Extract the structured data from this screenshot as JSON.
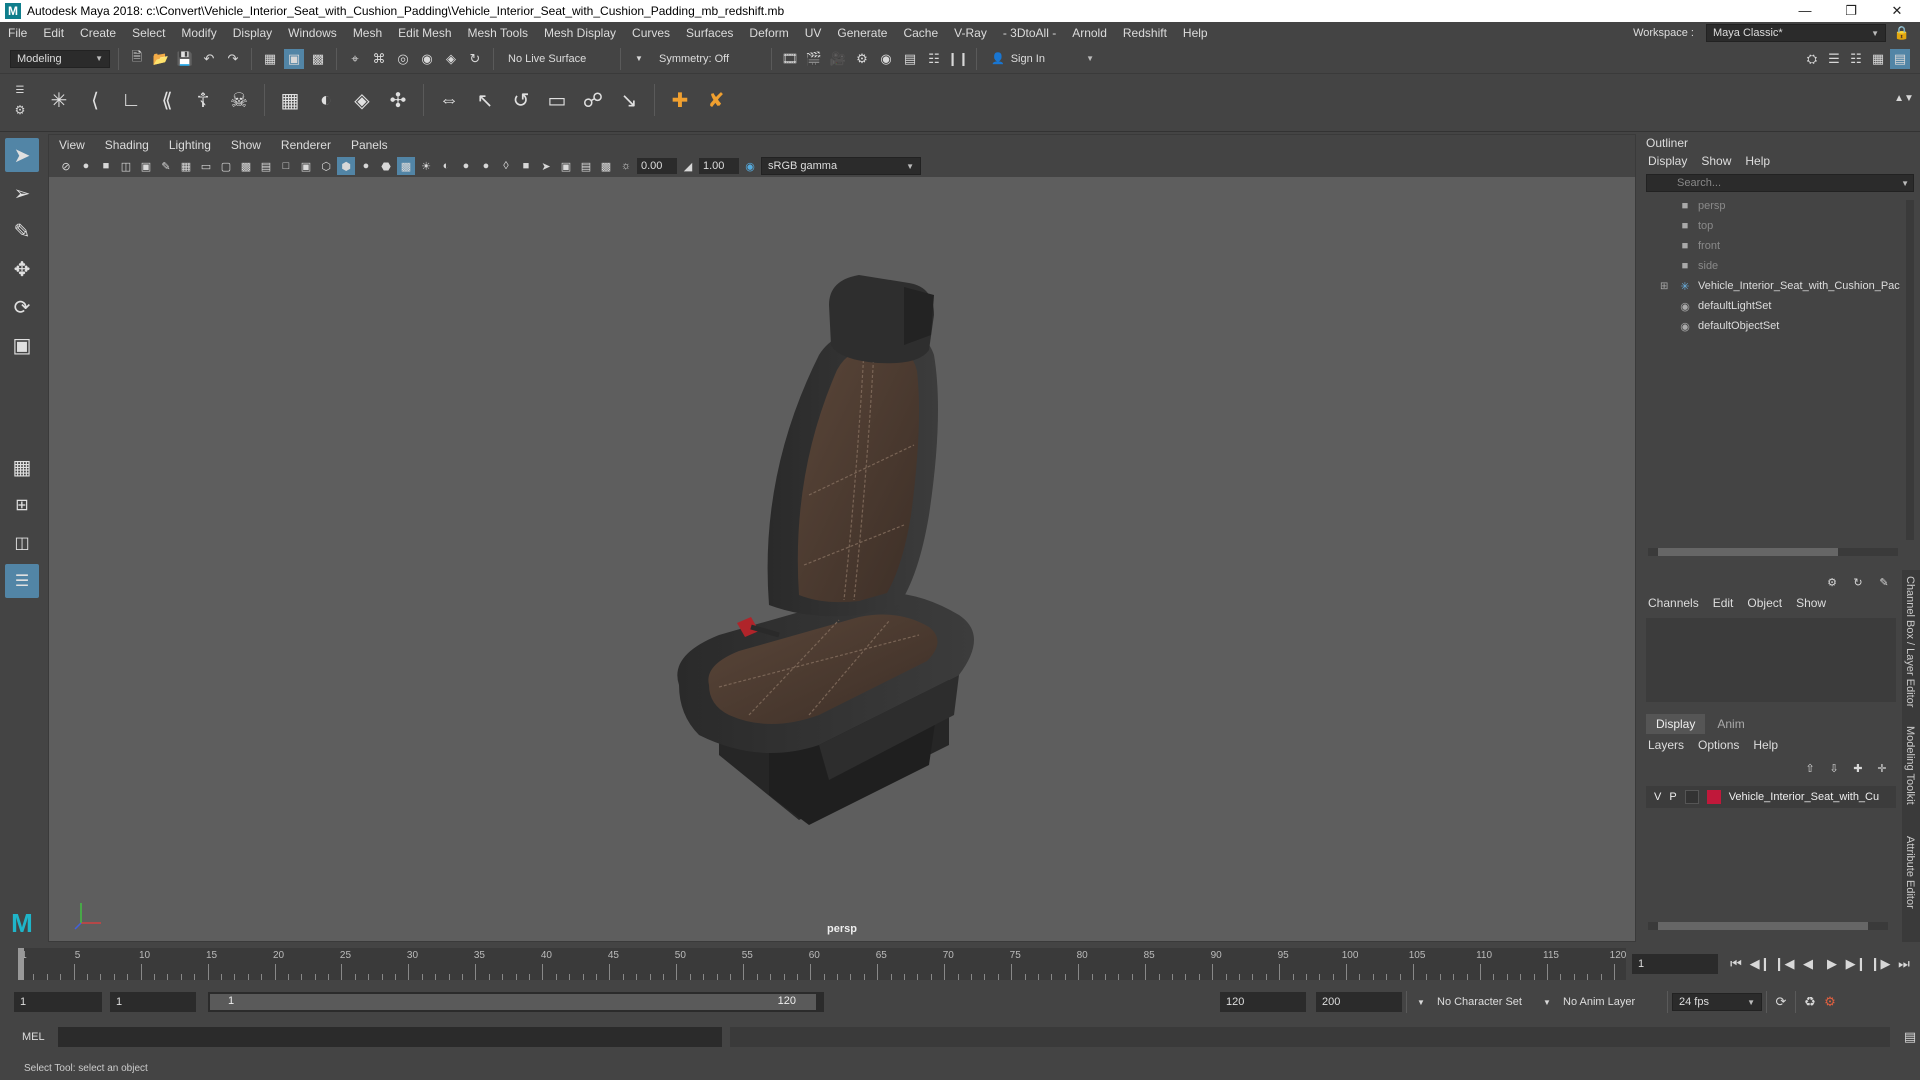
{
  "window": {
    "title": "Autodesk Maya 2018: c:\\Convert\\Vehicle_Interior_Seat_with_Cushion_Padding\\Vehicle_Interior_Seat_with_Cushion_Padding_mb_redshift.mb",
    "logo_text": "M"
  },
  "menubar": {
    "items": [
      "File",
      "Edit",
      "Create",
      "Select",
      "Modify",
      "Display",
      "Windows",
      "Mesh",
      "Edit Mesh",
      "Mesh Tools",
      "Mesh Display",
      "Curves",
      "Surfaces",
      "Deform",
      "UV",
      "Generate",
      "Cache",
      "V-Ray",
      "- 3DtoAll -",
      "Arnold",
      "Redshift",
      "Help"
    ],
    "workspace_label": "Workspace :",
    "workspace_value": "Maya Classic*"
  },
  "statusline": {
    "mode": "Modeling",
    "live_surface": "No Live Surface",
    "symmetry": "Symmetry: Off",
    "sign_in": "Sign In"
  },
  "viewport": {
    "menu": [
      "View",
      "Shading",
      "Lighting",
      "Show",
      "Renderer",
      "Panels"
    ],
    "exposure": "0.00",
    "gamma": "1.00",
    "color_space": "sRGB gamma",
    "camera": "persp"
  },
  "outliner": {
    "title": "Outliner",
    "menu": [
      "Display",
      "Show",
      "Help"
    ],
    "search_placeholder": "Search...",
    "items": [
      {
        "label": "persp",
        "dim": true
      },
      {
        "label": "top",
        "dim": true
      },
      {
        "label": "front",
        "dim": true
      },
      {
        "label": "side",
        "dim": true
      },
      {
        "label": "Vehicle_Interior_Seat_with_Cushion_Pac",
        "dim": false
      },
      {
        "label": "defaultLightSet",
        "dim": false
      },
      {
        "label": "defaultObjectSet",
        "dim": false
      }
    ]
  },
  "channelbox": {
    "menu": [
      "Channels",
      "Edit",
      "Object",
      "Show"
    ],
    "side_tab": "Channel Box / Layer Editor"
  },
  "layereditor": {
    "tabs": [
      "Display",
      "Anim"
    ],
    "menu": [
      "Layers",
      "Options",
      "Help"
    ],
    "layer": {
      "v": "V",
      "p": "P",
      "name": "Vehicle_Interior_Seat_with_Cu",
      "color": "#c0183a"
    }
  },
  "side_tabs": [
    "Modeling Toolkit",
    "Attribute Editor"
  ],
  "timeline": {
    "ticks": [
      1,
      5,
      10,
      15,
      20,
      25,
      30,
      35,
      40,
      45,
      50,
      55,
      60,
      65,
      70,
      75,
      80,
      85,
      90,
      95,
      100,
      105,
      110,
      115,
      120
    ],
    "current_frame": "1"
  },
  "range": {
    "start": "1",
    "playback_start": "1",
    "slider_start": "1",
    "slider_end": "120",
    "playback_end": "120",
    "end": "200",
    "character_set": "No Character Set",
    "anim_layer": "No Anim Layer",
    "fps": "24 fps"
  },
  "cmdline": {
    "label": "MEL"
  },
  "helpline": {
    "text": "Select Tool: select an object"
  }
}
